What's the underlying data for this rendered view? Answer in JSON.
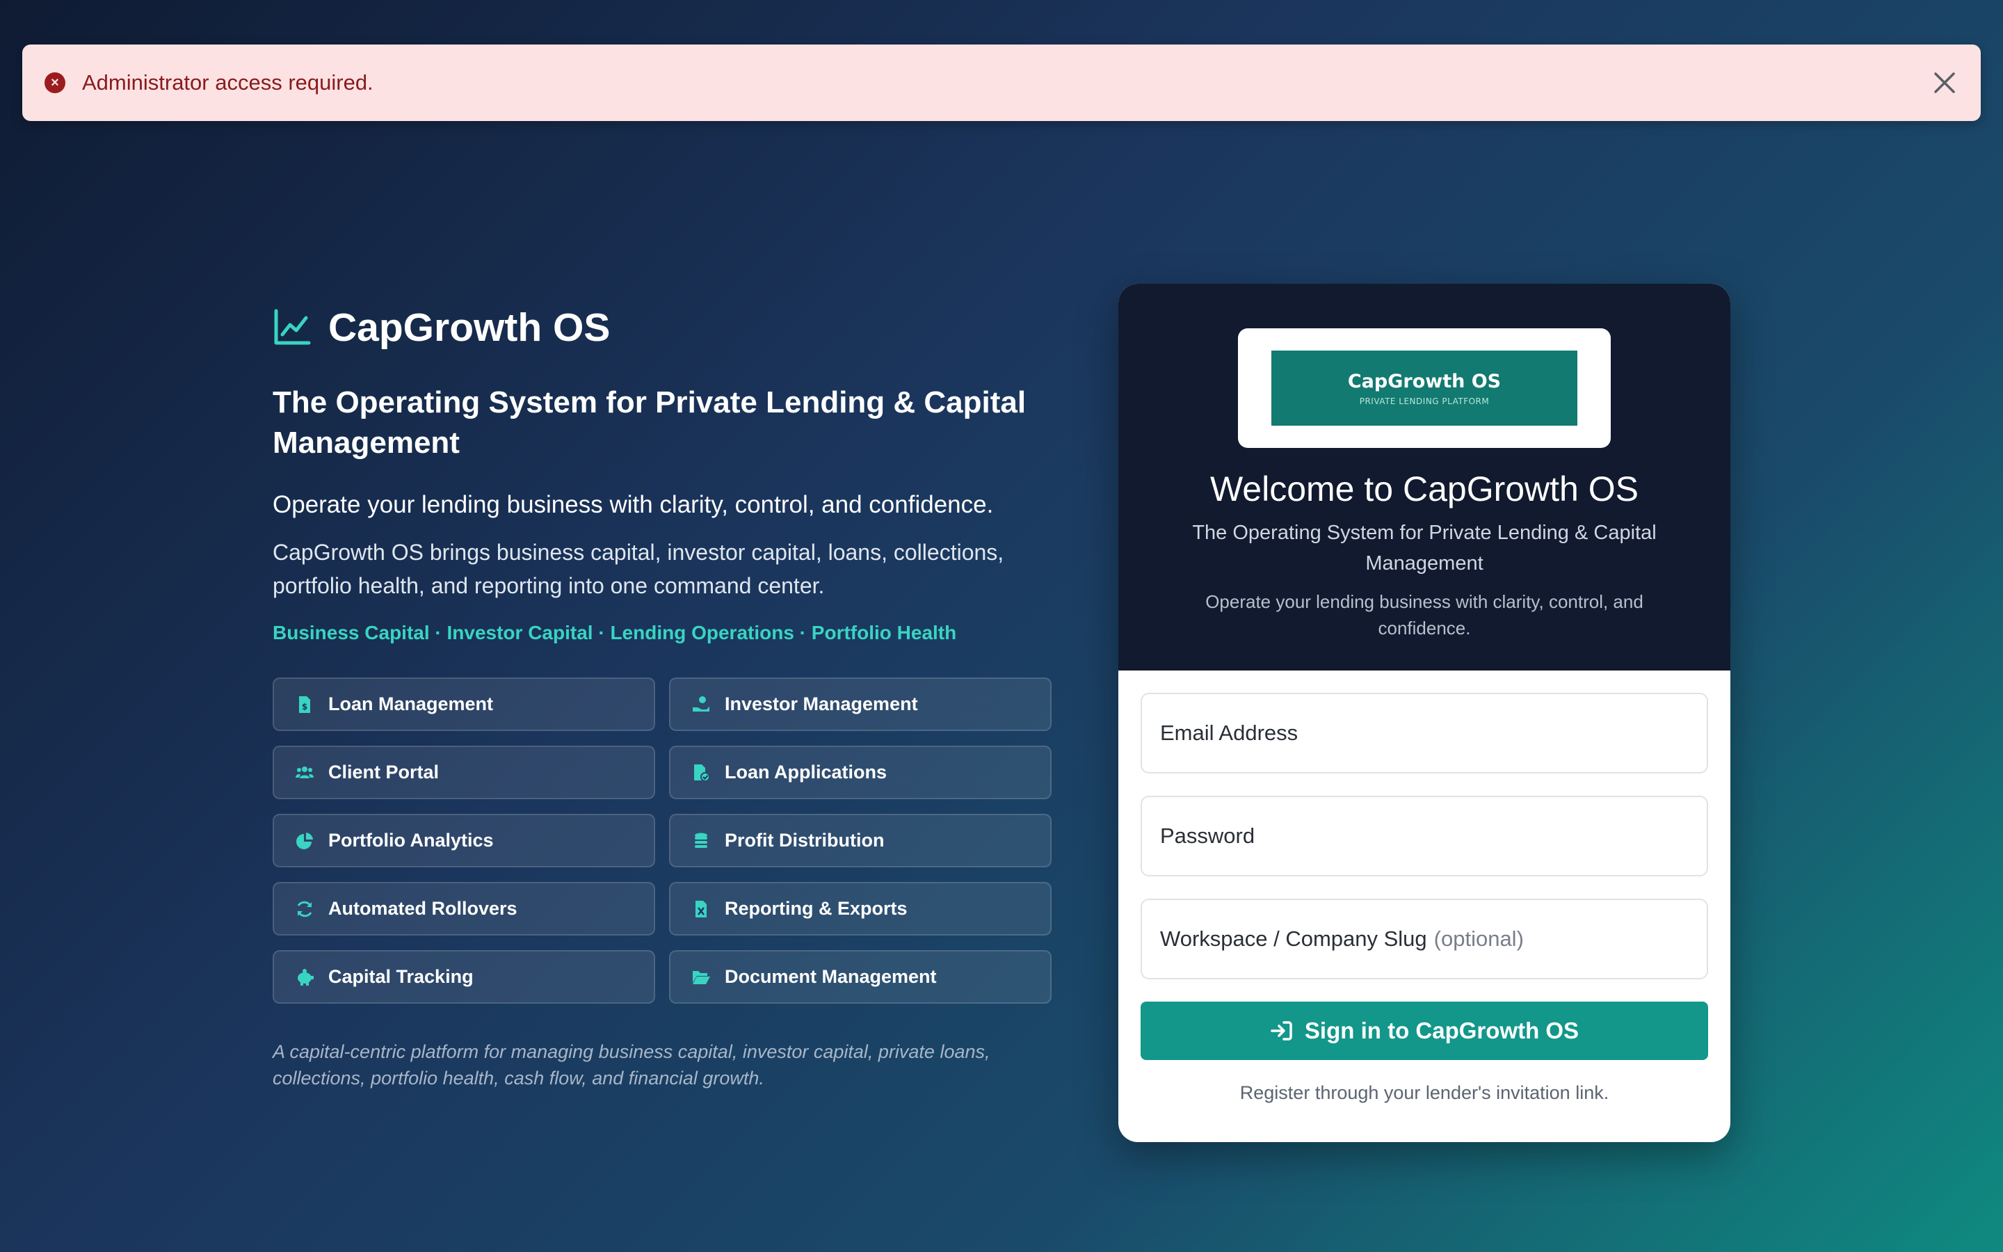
{
  "alert": {
    "message": "Administrator access required.",
    "icon": "error-circle-icon"
  },
  "brand": {
    "name": "CapGrowth OS",
    "icon": "chart-line-icon",
    "accent_color": "#39d4c2"
  },
  "hero": {
    "headline": "The Operating System for Private Lending & Capital Management",
    "subhead": "Operate your lending business with clarity, control, and confidence.",
    "description": "CapGrowth OS brings business capital, investor capital, loans, collections, portfolio health, and reporting into one command center.",
    "tags": "Business Capital · Investor Capital · Lending Operations · Portfolio Health",
    "tagline": "A capital-centric platform for managing business capital, investor capital, private loans, collections, portfolio health, cash flow, and financial growth."
  },
  "features": [
    {
      "label": "Loan Management",
      "icon": "file-invoice-dollar-icon"
    },
    {
      "label": "Investor Management",
      "icon": "hand-holding-dollar-icon"
    },
    {
      "label": "Client Portal",
      "icon": "users-icon"
    },
    {
      "label": "Loan Applications",
      "icon": "file-check-icon"
    },
    {
      "label": "Portfolio Analytics",
      "icon": "pie-chart-icon"
    },
    {
      "label": "Profit Distribution",
      "icon": "coins-icon"
    },
    {
      "label": "Automated Rollovers",
      "icon": "refresh-icon"
    },
    {
      "label": "Reporting & Exports",
      "icon": "file-excel-icon"
    },
    {
      "label": "Capital Tracking",
      "icon": "piggy-bank-icon"
    },
    {
      "label": "Document Management",
      "icon": "folder-open-icon"
    }
  ],
  "card": {
    "logo_title": "CapGrowth OS",
    "logo_subtitle": "PRIVATE LENDING PLATFORM",
    "welcome": "Welcome to CapGrowth OS",
    "subtitle": "The Operating System for Private Lending & Capital Management",
    "description": "Operate your lending business with clarity, control, and confidence.",
    "email_placeholder": "Email Address",
    "password_placeholder": "Password",
    "workspace_placeholder": "Workspace / Company Slug",
    "workspace_optional": "(optional)",
    "signin_label": "Sign in to CapGrowth OS",
    "signin_icon": "sign-in-icon",
    "register_text": "Register through your lender's invitation link.",
    "button_color": "#12978a"
  }
}
